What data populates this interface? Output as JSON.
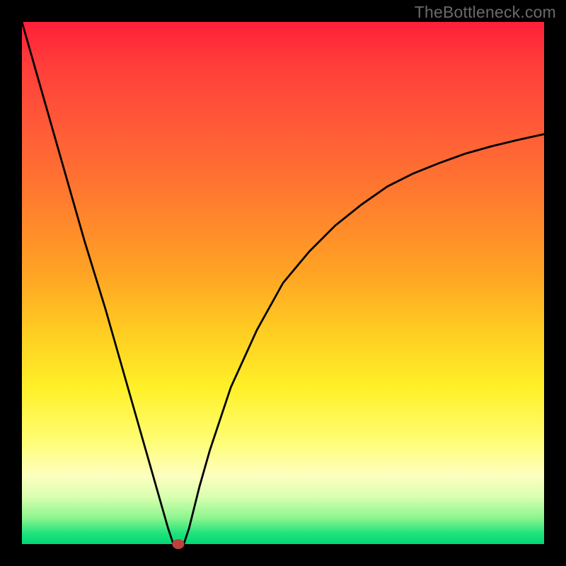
{
  "watermark": "TheBottleneck.com",
  "colors": {
    "curve": "#000000",
    "marker": "#c1403e",
    "gradient_top": "#ff1f3a",
    "gradient_mid": "#ffcf22",
    "gradient_bottom": "#00d878"
  },
  "chart_data": {
    "type": "line",
    "title": "",
    "xlabel": "",
    "ylabel": "",
    "xlim": [
      0,
      100
    ],
    "ylim": [
      0,
      100
    ],
    "x": [
      0,
      4,
      8,
      12,
      16,
      20,
      24,
      28,
      29,
      30,
      31,
      32,
      34,
      36,
      40,
      45,
      50,
      55,
      60,
      65,
      70,
      75,
      80,
      85,
      90,
      95,
      100
    ],
    "y": [
      100,
      86,
      72,
      58,
      45,
      31,
      17,
      3,
      0,
      0,
      0,
      3,
      11,
      18,
      30,
      41,
      50,
      56,
      61,
      65,
      68.5,
      71,
      73,
      74.8,
      76.2,
      77.4,
      78.5
    ],
    "marker": {
      "x": 30,
      "y": 0
    }
  }
}
